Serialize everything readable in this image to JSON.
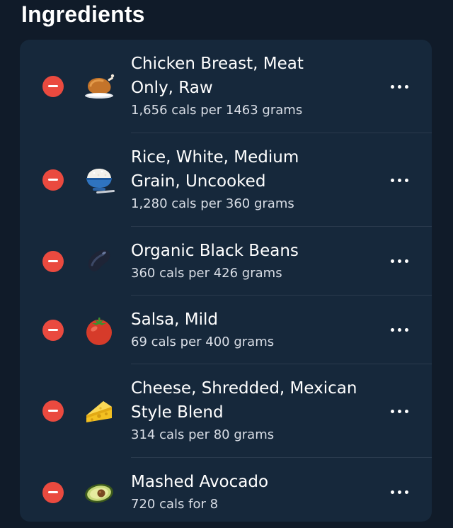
{
  "section": {
    "title": "Ingredients"
  },
  "ingredients": [
    {
      "name_lines": [
        "Chicken Breast, Meat",
        "Only, Raw"
      ],
      "subtitle": "1,656 cals per 1463 grams",
      "icon": "roast-chicken-icon"
    },
    {
      "name_lines": [
        "Rice, White, Medium",
        "Grain, Uncooked"
      ],
      "subtitle": "1,280 cals per 360 grams",
      "icon": "rice-bowl-icon"
    },
    {
      "name_lines": [
        "Organic Black Beans"
      ],
      "subtitle": "360 cals per 426 grams",
      "icon": "black-bean-icon"
    },
    {
      "name_lines": [
        "Salsa, Mild"
      ],
      "subtitle": "69 cals per 400 grams",
      "icon": "tomato-icon"
    },
    {
      "name_lines": [
        "Cheese, Shredded, Mexican",
        "Style Blend"
      ],
      "subtitle": "314 cals per 80 grams",
      "icon": "cheese-icon"
    },
    {
      "name_lines": [
        "Mashed Avocado"
      ],
      "subtitle": "720 cals for 8",
      "icon": "avocado-icon"
    }
  ],
  "colors": {
    "background": "#101b29",
    "card": "#16283b",
    "remove": "#ea4a3f",
    "divider": "#2a3a4d"
  }
}
